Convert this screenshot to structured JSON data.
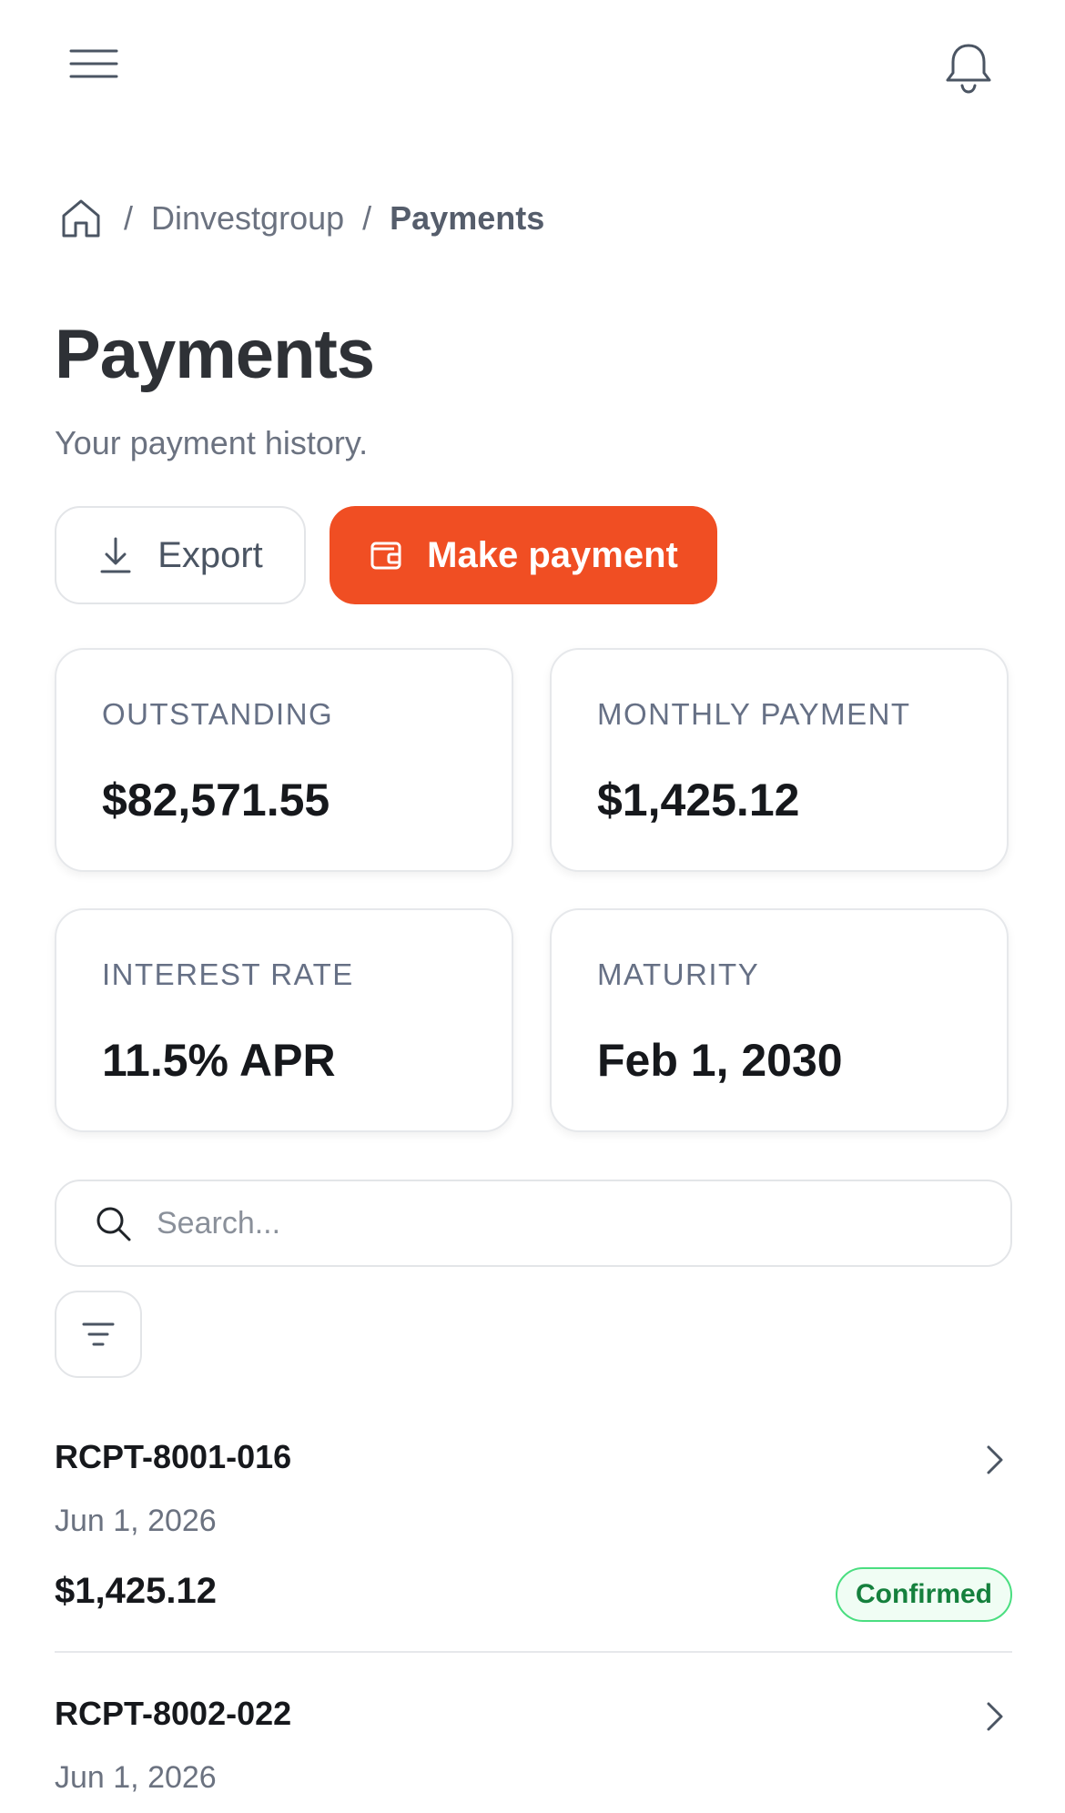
{
  "topbar": {
    "menu_icon": "hamburger-menu-icon",
    "notification_icon": "bell-icon"
  },
  "breadcrumb": {
    "home_icon": "home-icon",
    "separator": "/",
    "items": [
      "Dinvestgroup",
      "Payments"
    ]
  },
  "page": {
    "title": "Payments",
    "subtitle": "Your payment history."
  },
  "actions": {
    "export_label": "Export",
    "export_icon": "download-icon",
    "pay_label": "Make payment",
    "pay_icon": "wallet-icon"
  },
  "stats": [
    {
      "label": "OUTSTANDING",
      "value": "$82,571.55"
    },
    {
      "label": "MONTHLY PAYMENT",
      "value": "$1,425.12"
    },
    {
      "label": "INTEREST RATE",
      "value": "11.5% APR"
    },
    {
      "label": "MATURITY",
      "value": "Feb 1, 2030"
    }
  ],
  "search": {
    "placeholder": "Search...",
    "value": ""
  },
  "filter": {
    "icon": "filter-icon"
  },
  "payments": [
    {
      "receipt": "RCPT-8001-016",
      "date": "Jun 1, 2026",
      "amount": "$1,425.12",
      "status": "Confirmed"
    },
    {
      "receipt": "RCPT-8002-022",
      "date": "Jun 1, 2026"
    }
  ],
  "colors": {
    "primary": "#f04e23",
    "success_border": "#4ade80",
    "success_text": "#15803d",
    "text_muted": "#6b7280"
  }
}
